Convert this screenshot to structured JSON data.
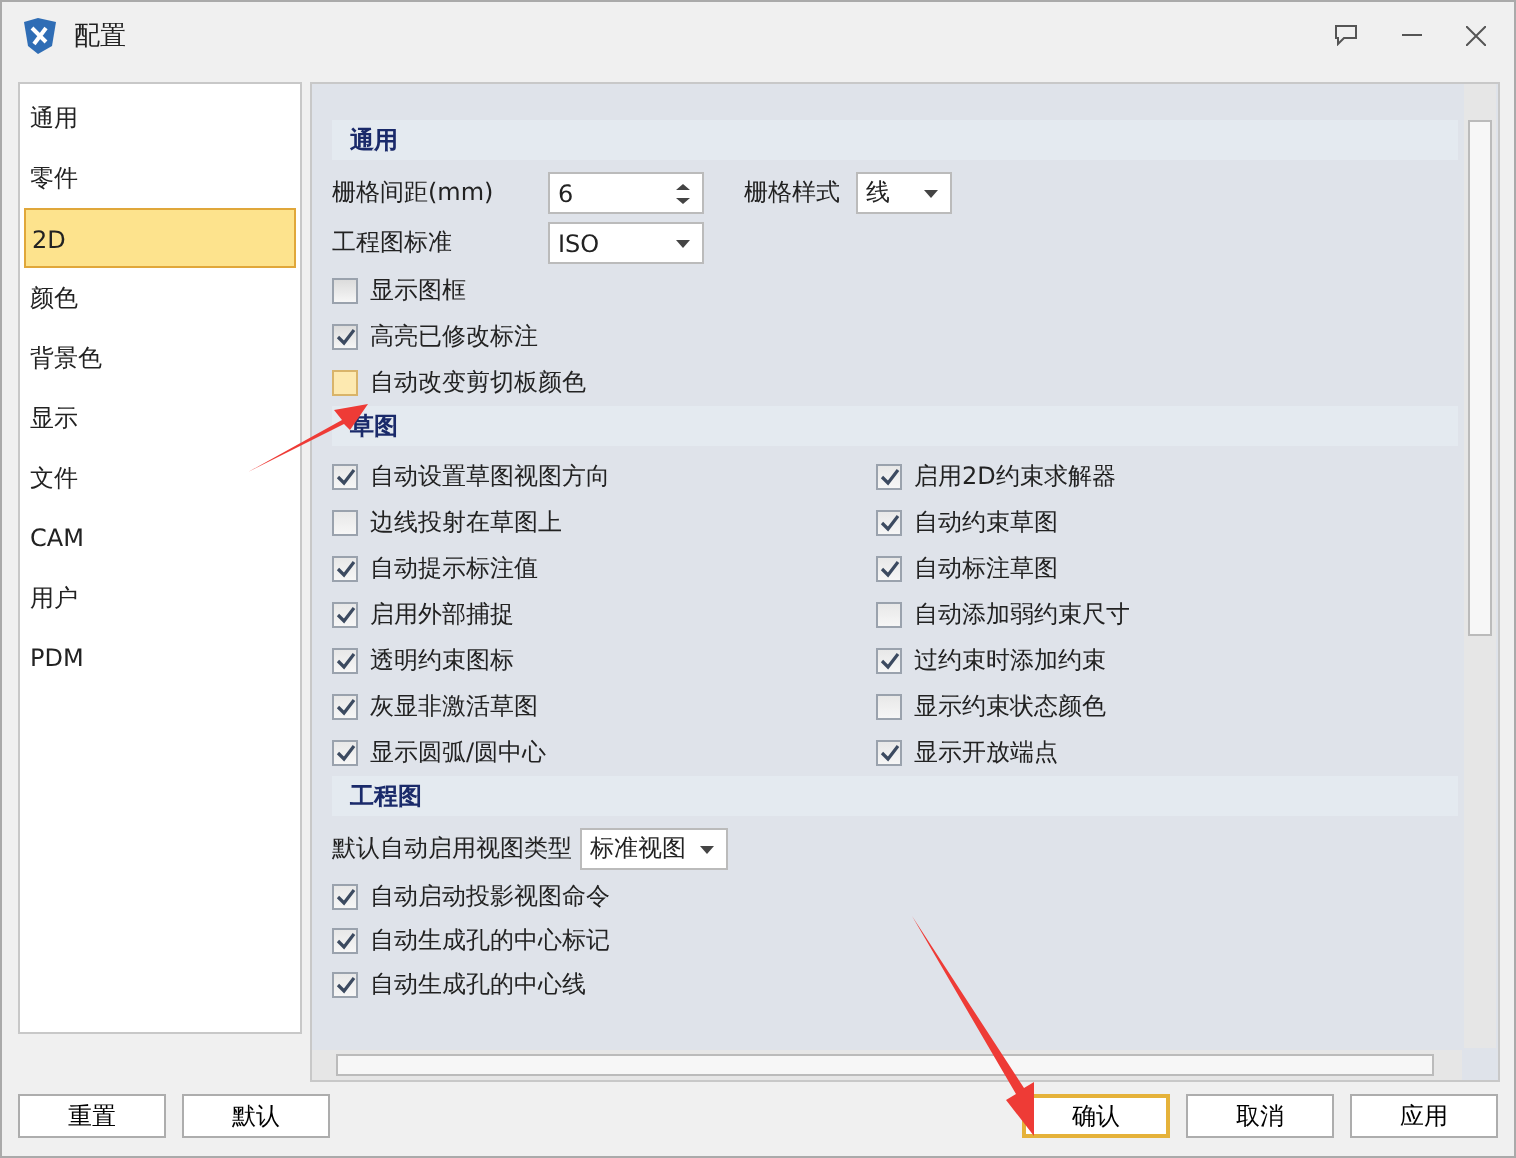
{
  "window": {
    "title": "配置"
  },
  "sidebar": {
    "items": [
      {
        "label": "通用",
        "selected": false
      },
      {
        "label": "零件",
        "selected": false
      },
      {
        "label": "2D",
        "selected": true
      },
      {
        "label": "颜色",
        "selected": false
      },
      {
        "label": "背景色",
        "selected": false
      },
      {
        "label": "显示",
        "selected": false
      },
      {
        "label": "文件",
        "selected": false
      },
      {
        "label": "CAM",
        "selected": false
      },
      {
        "label": "用户",
        "selected": false
      },
      {
        "label": "PDM",
        "selected": false
      }
    ]
  },
  "general": {
    "title": "通用",
    "grid_spacing": {
      "label": "栅格间距(mm)",
      "value": "6"
    },
    "grid_style": {
      "label": "栅格样式",
      "value": "线"
    },
    "drawing_standard": {
      "label": "工程图标准",
      "value": "ISO"
    },
    "options": [
      {
        "label": "显示图框",
        "checked": false,
        "highlighted": false
      },
      {
        "label": "高亮已修改标注",
        "checked": true,
        "highlighted": false
      },
      {
        "label": "自动改变剪切板颜色",
        "checked": false,
        "highlighted": true
      }
    ]
  },
  "sketch": {
    "title": "草图",
    "left": [
      {
        "label": "自动设置草图视图方向",
        "checked": true
      },
      {
        "label": "边线投射在草图上",
        "checked": false
      },
      {
        "label": "自动提示标注值",
        "checked": true
      },
      {
        "label": "启用外部捕捉",
        "checked": true
      },
      {
        "label": "透明约束图标",
        "checked": true
      },
      {
        "label": "灰显非激活草图",
        "checked": true
      },
      {
        "label": "显示圆弧/圆中心",
        "checked": true
      }
    ],
    "right": [
      {
        "label": "启用2D约束求解器",
        "checked": true
      },
      {
        "label": "自动约束草图",
        "checked": true
      },
      {
        "label": "自动标注草图",
        "checked": true
      },
      {
        "label": "自动添加弱约束尺寸",
        "checked": false
      },
      {
        "label": "过约束时添加约束",
        "checked": true
      },
      {
        "label": "显示约束状态颜色",
        "checked": false
      },
      {
        "label": "显示开放端点",
        "checked": true
      }
    ]
  },
  "drawing": {
    "title": "工程图",
    "view_type": {
      "label": "默认自动启用视图类型",
      "value": "标准视图"
    },
    "options": [
      {
        "label": "自动启动投影视图命令",
        "checked": true
      },
      {
        "label": "自动生成孔的中心标记",
        "checked": true
      },
      {
        "label": "自动生成孔的中心线",
        "checked": true
      }
    ]
  },
  "buttons_left": [
    {
      "label": "重置"
    },
    {
      "label": "默认"
    }
  ],
  "buttons_right": [
    {
      "label": "确认",
      "selected": true
    },
    {
      "label": "取消",
      "selected": false
    },
    {
      "label": "应用",
      "selected": false
    }
  ]
}
